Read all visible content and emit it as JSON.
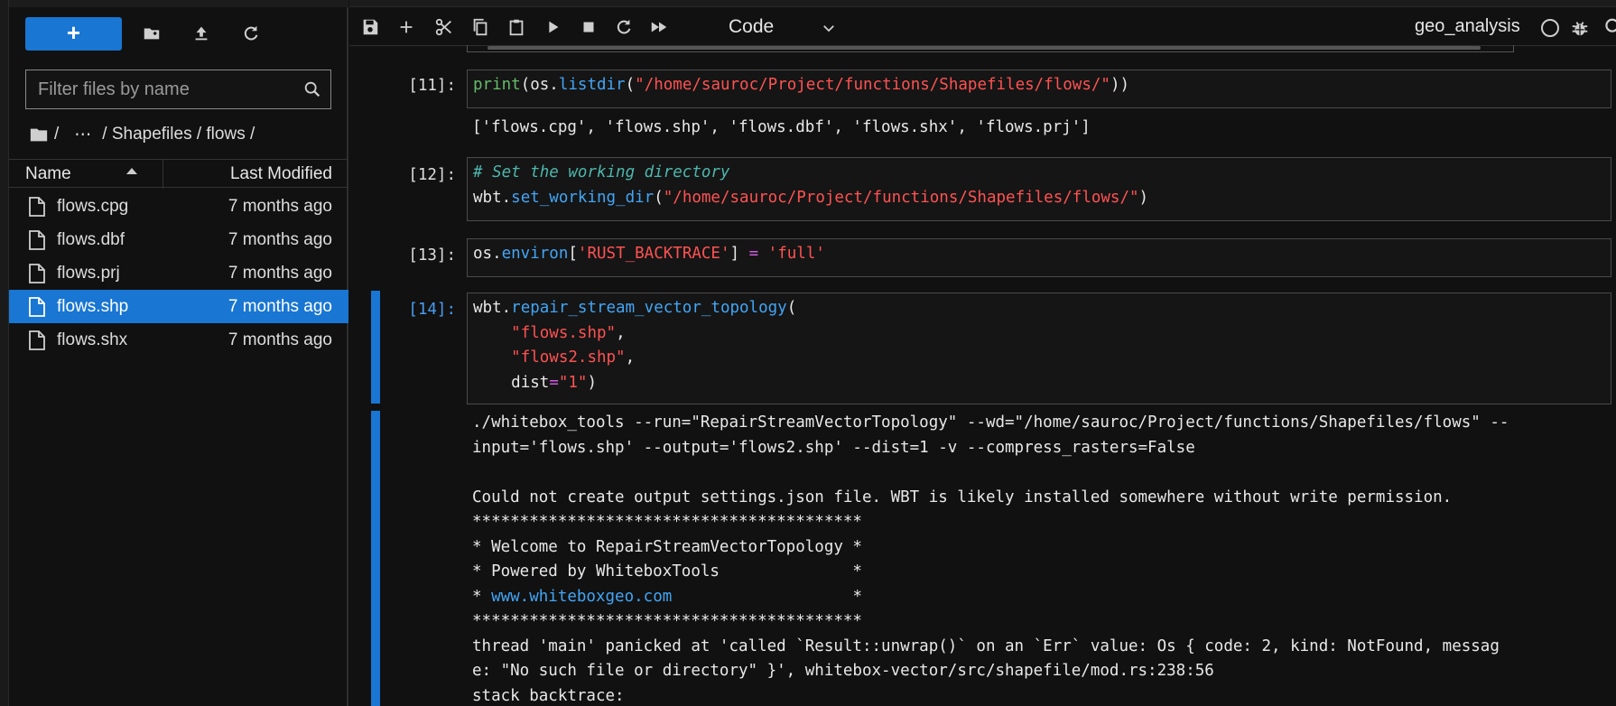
{
  "filebrowser": {
    "new_label": "+",
    "filter_placeholder": "Filter files by name",
    "breadcrumb": [
      "/",
      "⋯",
      "/ Shapefiles / flows /"
    ],
    "columns": {
      "name": "Name",
      "modified": "Last Modified"
    },
    "files": [
      {
        "name": "flows.cpg",
        "modified": "7 months ago",
        "selected": false
      },
      {
        "name": "flows.dbf",
        "modified": "7 months ago",
        "selected": false
      },
      {
        "name": "flows.prj",
        "modified": "7 months ago",
        "selected": false
      },
      {
        "name": "flows.shp",
        "modified": "7 months ago",
        "selected": true
      },
      {
        "name": "flows.shx",
        "modified": "7 months ago",
        "selected": false
      }
    ]
  },
  "toolbar": {
    "cell_type": "Code",
    "kernel_name": "geo_analysis"
  },
  "cells": {
    "c11": {
      "prompt": "[11]:",
      "code": {
        "fn_print": "print",
        "p1": "(os.",
        "fn_listdir": "listdir",
        "p2": "(",
        "path": "\"/home/sauroc/Project/functions/Shapefiles/flows/\"",
        "p3": "))"
      },
      "output": "['flows.cpg', 'flows.shp', 'flows.dbf', 'flows.shx', 'flows.prj']"
    },
    "c12": {
      "prompt": "[12]:",
      "comment": "# Set the working directory",
      "obj": "wbt.",
      "fn": "set_working_dir",
      "open": "(",
      "path": "\"/home/sauroc/Project/functions/Shapefiles/flows/\"",
      "close": ")"
    },
    "c13": {
      "prompt": "[13]:",
      "obj": "os.",
      "attr": "environ",
      "open": "[",
      "key": "'RUST_BACKTRACE'",
      "close": "] ",
      "op": "=",
      "space": " ",
      "val": "'full'"
    },
    "c14": {
      "prompt": "[14]:",
      "obj": "wbt.",
      "fn": "repair_stream_vector_topology",
      "open": "(",
      "indent": "    ",
      "arg1": "\"flows.shp\"",
      "comma": ",",
      "arg2": "\"flows2.shp\"",
      "kw": "dist",
      "eq": "=",
      "arg3": "\"1\"",
      "close": ")",
      "output": {
        "cmd1": "./whitebox_tools --run=\"RepairStreamVectorTopology\" --wd=\"/home/sauroc/Project/functions/Shapefiles/flows\" --",
        "cmd2": "input='flows.shp' --output='flows2.shp' --dist=1 -v --compress_rasters=False",
        "warn": "Could not create output settings.json file. WBT is likely installed somewhere without write permission.",
        "stars": "*****************************************",
        "welcome": "* Welcome to RepairStreamVectorTopology *",
        "powered": "* Powered by WhiteboxTools              *",
        "url_pre": "* ",
        "url": "www.whiteboxgeo.com",
        "url_post": "                   *",
        "panic1": "thread 'main' panicked at 'called `Result::unwrap()` on an `Err` value: Os { code: 2, kind: NotFound, messag",
        "panic2": "e: \"No such file or directory\" }', whitebox-vector/src/shapefile/mod.rs:238:56",
        "backtrace": "stack backtrace:"
      }
    }
  }
}
